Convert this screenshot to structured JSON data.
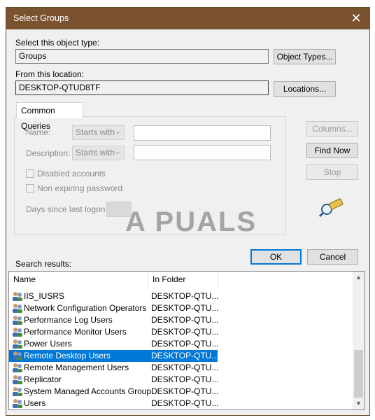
{
  "window": {
    "title": "Select Groups",
    "close_glyph": "✕"
  },
  "object_type": {
    "label": "Select this object type:",
    "value": "Groups",
    "button": "Object Types..."
  },
  "location": {
    "label": "From this location:",
    "value": "DESKTOP-QTUD8TF",
    "button": "Locations..."
  },
  "queries": {
    "tab": "Common Queries",
    "name_label": "Name:",
    "name_mode": "Starts with",
    "description_label": "Description:",
    "description_mode": "Starts with",
    "disabled_accounts": "Disabled accounts",
    "non_expiring": "Non expiring password",
    "days_label": "Days since last logon:"
  },
  "side_buttons": {
    "columns": "Columns...",
    "find_now": "Find Now",
    "stop": "Stop"
  },
  "footer": {
    "ok": "OK",
    "cancel": "Cancel"
  },
  "results": {
    "label": "Search results:",
    "columns": [
      "Name",
      "In Folder"
    ],
    "rows": [
      {
        "name": "IIS_IUSRS",
        "folder": "DESKTOP-QTU..."
      },
      {
        "name": "Network Configuration Operators",
        "folder": "DESKTOP-QTU..."
      },
      {
        "name": "Performance Log Users",
        "folder": "DESKTOP-QTU..."
      },
      {
        "name": "Performance Monitor Users",
        "folder": "DESKTOP-QTU..."
      },
      {
        "name": "Power Users",
        "folder": "DESKTOP-QTU..."
      },
      {
        "name": "Remote Desktop Users",
        "folder": "DESKTOP-QTU...",
        "selected": true
      },
      {
        "name": "Remote Management Users",
        "folder": "DESKTOP-QTU..."
      },
      {
        "name": "Replicator",
        "folder": "DESKTOP-QTU..."
      },
      {
        "name": "System Managed Accounts Group",
        "folder": "DESKTOP-QTU..."
      },
      {
        "name": "Users",
        "folder": "DESKTOP-QTU..."
      }
    ]
  },
  "watermark": "A  PUALS",
  "colors": {
    "titlebar": "#7a5230",
    "selection": "#0078d7"
  },
  "icons": {
    "row": "group-icon",
    "search": "search-magnifier-icon"
  }
}
